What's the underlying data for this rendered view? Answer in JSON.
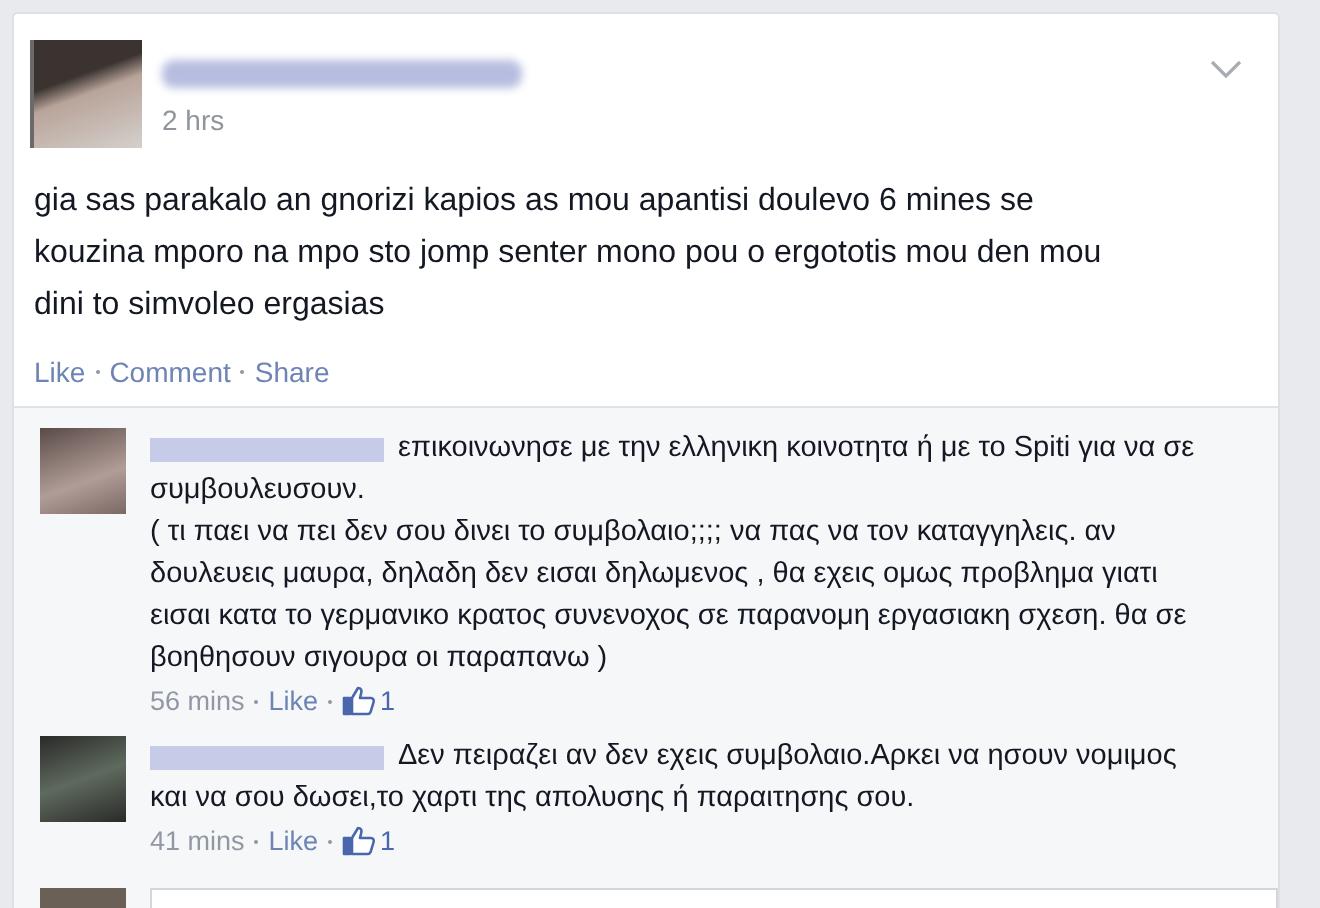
{
  "post": {
    "time": "2 hrs",
    "text": "gia sas parakalo an gnorizi kapios as mou apantisi doulevo 6 mines se kouzina mporo na mpo sto jomp senter mono pou o ergototis mou den mou dini to simvoleo ergasias",
    "actions": [
      "Like",
      "Comment",
      "Share"
    ]
  },
  "comments": [
    {
      "text": "επικοινωνησε με την ελληνικη κοινοτητα ή με το Spiti για να σε συμβουλευσουν.\n( τι παει να πει δεν σου δινει το συμβολαιο;;;; να πας να τον καταγγηλεις. αν δουλευεις μαυρα, δηλαδη δεν εισαι δηλωμενος , θα εχεις ομως προβλημα γιατι εισαι κατα το γερμανικο κρατος συνενοχος σε παρανομη εργασιακη σχεση. θα σε βοηθησουν σιγουρα οι παραπανω )",
      "time": "56 mins",
      "like": "Like",
      "likes": "1"
    },
    {
      "text": "Δεν πειραζει αν δεν εχεις συμβολαιο.Αρκει να ησουν νομιμος και να σου δωσει,το χαρτι της απολυσης ή παραιτησης σου.",
      "time": "41 mins",
      "like": "Like",
      "likes": "1"
    }
  ]
}
